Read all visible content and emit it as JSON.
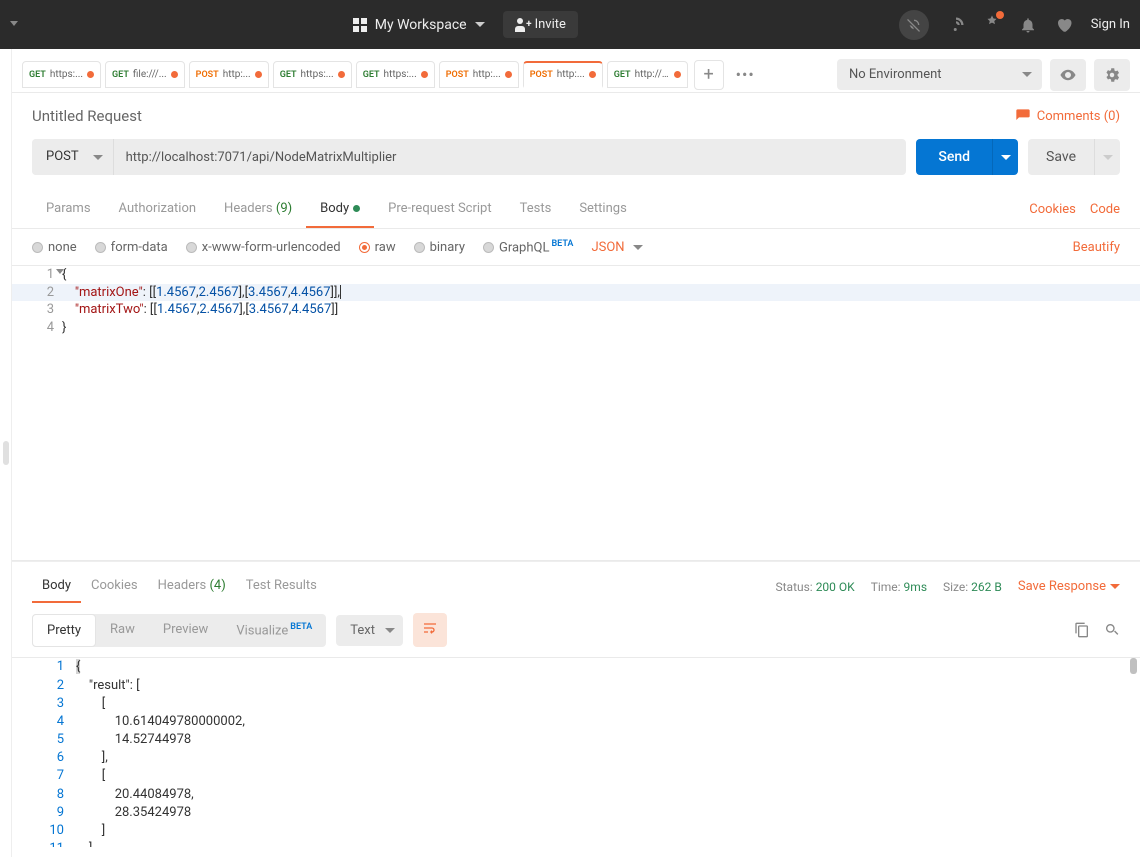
{
  "topbar": {
    "workspace": "My Workspace",
    "invite": "Invite",
    "signin": "Sign In"
  },
  "tabs": [
    {
      "method": "GET",
      "url": "https:..."
    },
    {
      "method": "GET",
      "url": "file:///..."
    },
    {
      "method": "POST",
      "url": "http:..."
    },
    {
      "method": "GET",
      "url": "https:..."
    },
    {
      "method": "GET",
      "url": "https:..."
    },
    {
      "method": "POST",
      "url": "http:..."
    },
    {
      "method": "POST",
      "url": "http:...",
      "active": true
    },
    {
      "method": "GET",
      "url": "http://..."
    }
  ],
  "environment": "No Environment",
  "request": {
    "title": "Untitled Request",
    "comments": "Comments (0)",
    "method": "POST",
    "url": "http://localhost:7071/api/NodeMatrixMultiplier",
    "send": "Send",
    "save": "Save"
  },
  "requestTabs": {
    "params": "Params",
    "authorization": "Authorization",
    "headers": "Headers",
    "headersCount": "(9)",
    "body": "Body",
    "prerequest": "Pre-request Script",
    "tests": "Tests",
    "settings": "Settings",
    "cookies": "Cookies",
    "code": "Code"
  },
  "bodyTypes": {
    "none": "none",
    "formdata": "form-data",
    "urlencoded": "x-www-form-urlencoded",
    "raw": "raw",
    "binary": "binary",
    "graphql": "GraphQL",
    "beta": "BETA",
    "format": "JSON",
    "beautify": "Beautify"
  },
  "requestBody": {
    "line1": "{",
    "l2_key": "\"matrixOne\"",
    "l2_a": "1.4567",
    "l2_b": "2.4567",
    "l2_c": "3.4567",
    "l2_d": "4.4567",
    "l3_key": "\"matrixTwo\"",
    "l3_a": "1.4567",
    "l3_b": "2.4567",
    "l3_c": "3.4567",
    "l3_d": "4.4567",
    "line4": "}"
  },
  "respTabs": {
    "body": "Body",
    "cookies": "Cookies",
    "headers": "Headers",
    "headersCount": "(4)",
    "testresults": "Test Results"
  },
  "respMeta": {
    "statusLabel": "Status:",
    "status": "200 OK",
    "timeLabel": "Time:",
    "time": "9ms",
    "sizeLabel": "Size:",
    "size": "262 B",
    "saveResponse": "Save Response"
  },
  "viewRow": {
    "pretty": "Pretty",
    "raw": "Raw",
    "preview": "Preview",
    "visualize": "Visualize",
    "beta": "BETA",
    "format": "Text"
  },
  "responseBody": [
    "{",
    "    \"result\": [",
    "        [",
    "            10.614049780000002,",
    "            14.52744978",
    "        ],",
    "        [",
    "            20.44084978,",
    "            28.35424978",
    "        ]",
    "    ]"
  ]
}
